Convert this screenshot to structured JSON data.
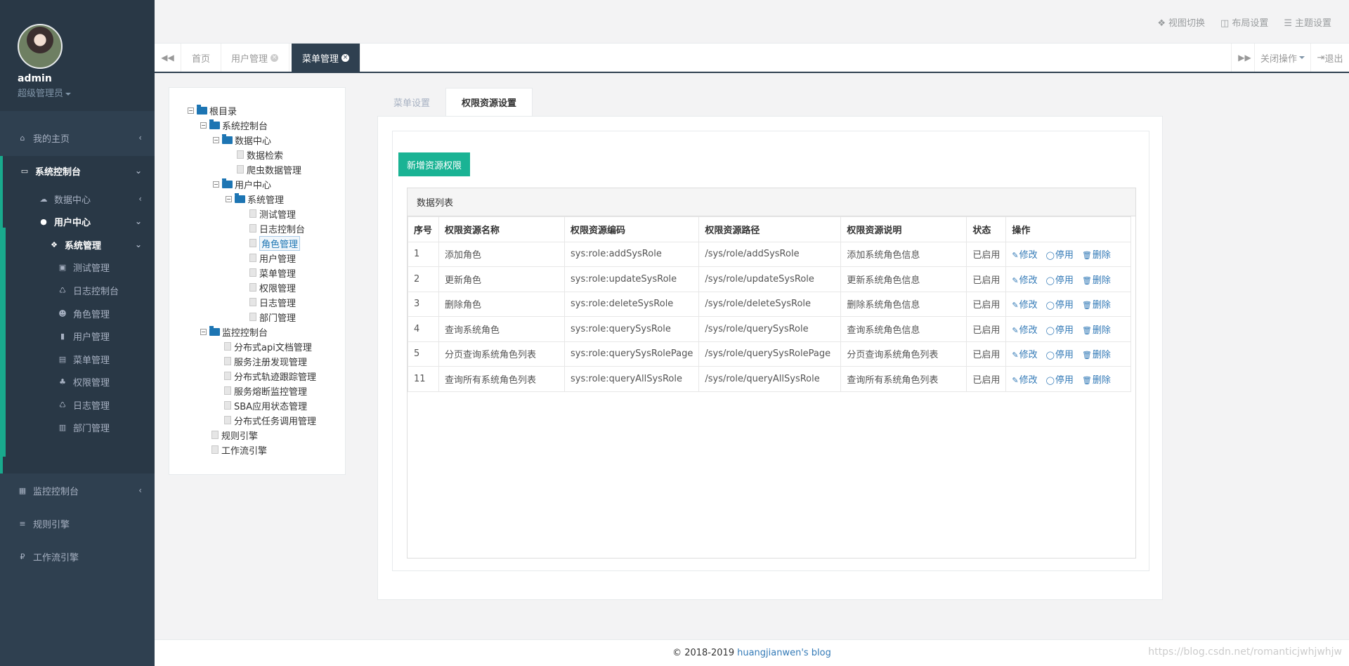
{
  "user": {
    "name": "admin",
    "role": "超级管理员"
  },
  "nav": {
    "home": "我的主页",
    "system_console": "系统控制台",
    "data_center": "数据中心",
    "user_center": "用户中心",
    "system_manage": "系统管理",
    "subitems": [
      "测试管理",
      "日志控制台",
      "角色管理",
      "用户管理",
      "菜单管理",
      "权限管理",
      "日志管理",
      "部门管理"
    ],
    "monitor_console": "监控控制台",
    "rule_engine": "规则引擎",
    "workflow_engine": "工作流引擎"
  },
  "toplinks": {
    "view_switch": "视图切换",
    "layout_settings": "布局设置",
    "theme_settings": "主题设置"
  },
  "tabs": {
    "home": "首页",
    "user_manage": "用户管理",
    "menu_manage": "菜单管理",
    "close_ops": "关闭操作",
    "logout": "退出"
  },
  "tree": {
    "root": "根目录",
    "system_console": "系统控制台",
    "data_center": "数据中心",
    "data_search": "数据检索",
    "crawler_data": "爬虫数据管理",
    "user_center": "用户中心",
    "system_manage": "系统管理",
    "items": [
      "测试管理",
      "日志控制台",
      "角色管理",
      "用户管理",
      "菜单管理",
      "权限管理",
      "日志管理",
      "部门管理"
    ],
    "monitor_console": "监控控制台",
    "monitor_items": [
      "分布式api文档管理",
      "服务注册发现管理",
      "分布式轨迹跟踪管理",
      "服务熔断监控管理",
      "SBA应用状态管理",
      "分布式任务调用管理"
    ],
    "rule_engine": "规则引擎",
    "workflow_engine": "工作流引擎"
  },
  "main": {
    "tab_menu": "菜单设置",
    "tab_perm": "权限资源设置",
    "add_button": "新增资源权限",
    "list_title": "数据列表",
    "columns": [
      "序号",
      "权限资源名称",
      "权限资源编码",
      "权限资源路径",
      "权限资源说明",
      "状态",
      "操作"
    ],
    "rows": [
      [
        "1",
        "添加角色",
        "sys:role:addSysRole",
        "/sys/role/addSysRole",
        "添加系统角色信息",
        "已启用"
      ],
      [
        "2",
        "更新角色",
        "sys:role:updateSysRole",
        "/sys/role/updateSysRole",
        "更新系统角色信息",
        "已启用"
      ],
      [
        "3",
        "删除角色",
        "sys:role:deleteSysRole",
        "/sys/role/deleteSysRole",
        "删除系统角色信息",
        "已启用"
      ],
      [
        "4",
        "查询系统角色",
        "sys:role:querySysRole",
        "/sys/role/querySysRole",
        "查询系统角色信息",
        "已启用"
      ],
      [
        "5",
        "分页查询系统角色列表",
        "sys:role:querySysRolePage",
        "/sys/role/querySysRolePage",
        "分页查询系统角色列表",
        "已启用"
      ],
      [
        "11",
        "查询所有系统角色列表",
        "sys:role:queryAllSysRole",
        "/sys/role/queryAllSysRole",
        "查询所有系统角色列表",
        "已启用"
      ]
    ],
    "ops": {
      "edit": "修改",
      "disable": "停用",
      "delete": "删除"
    }
  },
  "footer": {
    "copyright": "© 2018-2019",
    "link": "huangjianwen's blog"
  },
  "watermark": "https://blog.csdn.net/romanticjwhjwhjw",
  "colors": {
    "sidebar": "#2f4050",
    "accent": "#1ab394",
    "link": "#337ab7"
  }
}
